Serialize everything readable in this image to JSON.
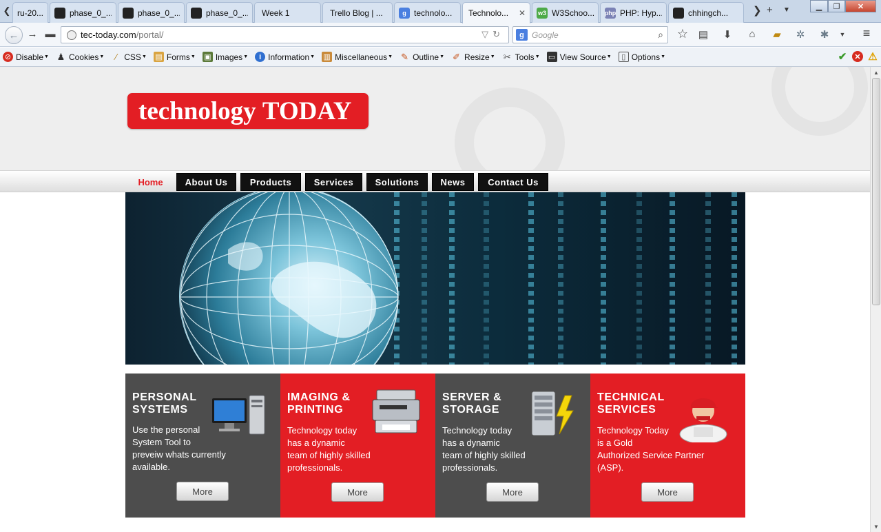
{
  "browser": {
    "tabs": [
      {
        "title": "ru-20...",
        "icon": "blank-page-icon",
        "active": false
      },
      {
        "title": "phase_0_...",
        "icon": "github-icon",
        "active": false
      },
      {
        "title": "phase_0_...",
        "icon": "github-icon",
        "active": false
      },
      {
        "title": "phase_0_...",
        "icon": "github-icon",
        "active": false
      },
      {
        "title": "Week 1",
        "icon": "blank-page-icon",
        "active": false
      },
      {
        "title": "Trello Blog | ...",
        "icon": "blank-page-icon",
        "active": false
      },
      {
        "title": "technolo...",
        "icon": "google-icon",
        "active": false
      },
      {
        "title": "Technolo...",
        "icon": "blank-page-icon",
        "active": true
      },
      {
        "title": "W3Schoo...",
        "icon": "w3schools-icon",
        "active": false
      },
      {
        "title": "PHP: Hyp...",
        "icon": "php-icon",
        "active": false
      },
      {
        "title": "chhingch...",
        "icon": "github-icon",
        "active": false
      }
    ],
    "url_host": "tec-today.com",
    "url_path": "/portal/",
    "search_engine_label": "g",
    "search_placeholder": "Google"
  },
  "devtoolbar": {
    "items": [
      {
        "label": "Disable",
        "icon": "no-entry-icon"
      },
      {
        "label": "Cookies",
        "icon": "cookie-person-icon"
      },
      {
        "label": "CSS",
        "icon": "css-wand-icon"
      },
      {
        "label": "Forms",
        "icon": "forms-icon"
      },
      {
        "label": "Images",
        "icon": "image-icon"
      },
      {
        "label": "Information",
        "icon": "info-icon"
      },
      {
        "label": "Miscellaneous",
        "icon": "misc-book-icon"
      },
      {
        "label": "Outline",
        "icon": "pencil-icon"
      },
      {
        "label": "Resize",
        "icon": "ruler-pencil-icon"
      },
      {
        "label": "Tools",
        "icon": "tools-icon"
      },
      {
        "label": "View Source",
        "icon": "view-source-icon"
      },
      {
        "label": "Options",
        "icon": "options-icon"
      }
    ]
  },
  "site": {
    "logo": {
      "word1": "technology",
      "word2": "TODAY"
    },
    "menu": {
      "home": "Home",
      "items": [
        "About Us",
        "Products",
        "Services",
        "Solutions",
        "News",
        "Contact Us"
      ]
    },
    "cards": [
      {
        "title": [
          "PERSONAL",
          "SYSTEMS"
        ],
        "text": [
          "Use the personal",
          "System Tool to",
          "preveiw whats currently",
          "available."
        ],
        "button": "More",
        "image": "desktop-computer-icon"
      },
      {
        "title": [
          "IMAGING &",
          "PRINTING"
        ],
        "text": [
          "Technology today",
          "has a dynamic",
          "team of highly skilled",
          "professionals."
        ],
        "button": "More",
        "image": "printer-icon"
      },
      {
        "title": [
          "SERVER &",
          "STORAGE"
        ],
        "text": [
          "Technology today",
          "has a dynamic",
          "team of highly skilled",
          "professionals."
        ],
        "button": "More",
        "image": "server-icon"
      },
      {
        "title": [
          "TECHNICAL",
          "SERVICES"
        ],
        "text": [
          "Technology Today",
          "is a Gold",
          "Authorized Service Partner",
          "(ASP)."
        ],
        "button": "More",
        "image": "technician-icon"
      }
    ]
  },
  "colors": {
    "brand_red": "#e31e24",
    "card_dark": "#4d4d4d",
    "menu_black": "#111111"
  }
}
